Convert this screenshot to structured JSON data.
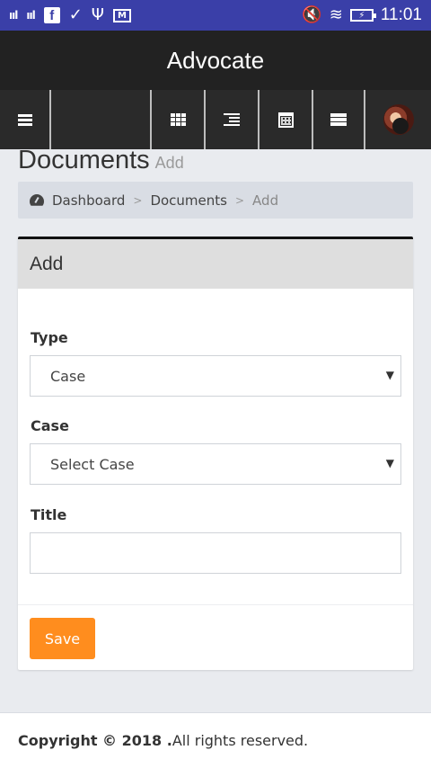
{
  "status_bar": {
    "time": "11:01",
    "signal_1": "ııl",
    "signal_2": "ııl",
    "fb_letter": "f",
    "icons": [
      "signal-icon",
      "signal-icon",
      "facebook-icon",
      "check-icon",
      "usb-icon",
      "mail-icon",
      "mute-icon",
      "wifi-icon",
      "battery-charging-icon"
    ]
  },
  "app": {
    "title": "Advocate"
  },
  "toolbar": {
    "icons": [
      "menu-icon",
      "grid-icon",
      "indent-icon",
      "calendar-icon",
      "list-icon",
      "avatar"
    ]
  },
  "page": {
    "title": "Documents",
    "subtitle": "Add"
  },
  "breadcrumb": {
    "items": [
      "Dashboard",
      "Documents",
      "Add"
    ],
    "separator": ">"
  },
  "card": {
    "header": "Add",
    "fields": {
      "type": {
        "label": "Type",
        "value": "Case"
      },
      "case": {
        "label": "Case",
        "value": "Select Case"
      },
      "title": {
        "label": "Title",
        "value": ""
      }
    },
    "save_label": "Save"
  },
  "footer": {
    "copyright": "Copyright © 2018 .",
    "rest": " All rights reserved."
  },
  "colors": {
    "status_bar": "#3a3fa8",
    "app_bar": "#222222",
    "toolbar": "#2a2a2a",
    "save_button": "#ff8d1e",
    "background": "#e9ebef"
  }
}
